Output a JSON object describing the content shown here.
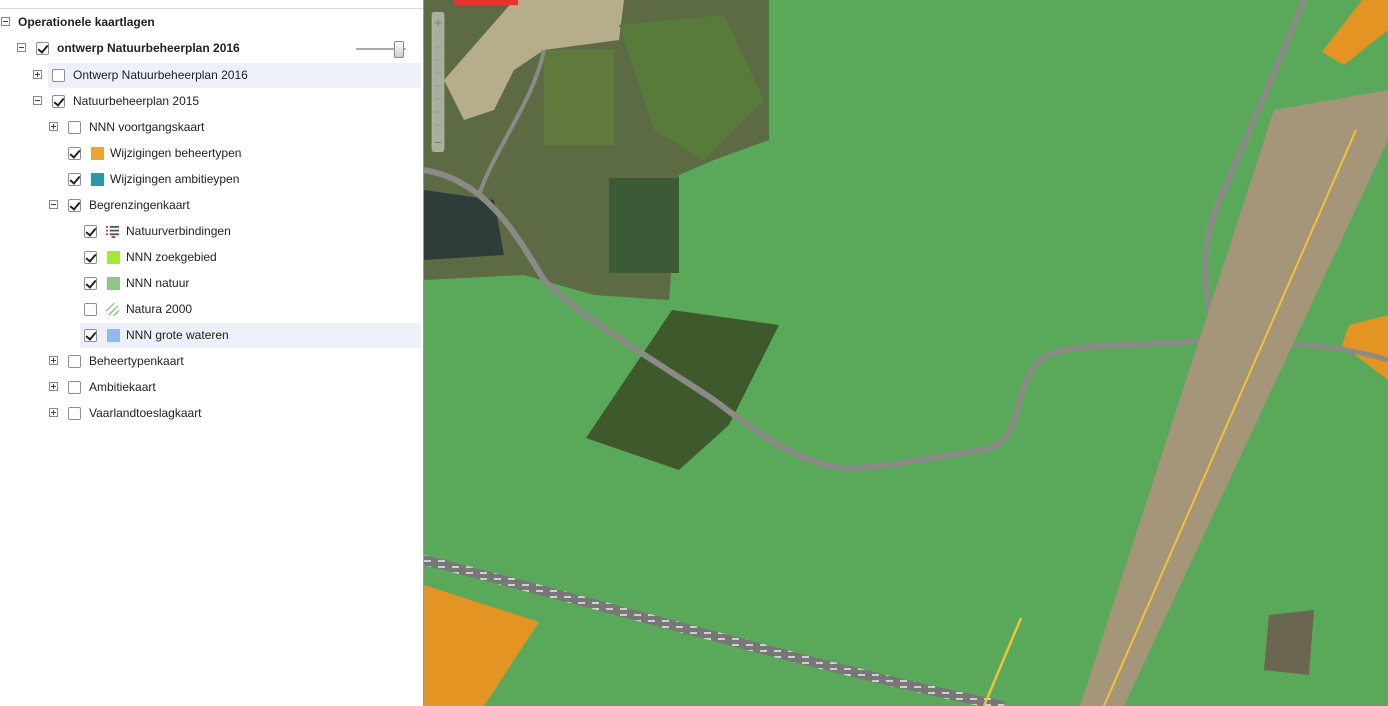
{
  "toc": {
    "root_label": "Operationele kaartlagen",
    "items": [
      {
        "label": "ontwerp Natuurbeheerplan 2016",
        "checked": true,
        "expander": "minus"
      },
      {
        "label": "Ontwerp Natuurbeheerplan 2016",
        "checked": false,
        "expander": "plus"
      },
      {
        "label": "Natuurbeheerplan 2015",
        "checked": true,
        "expander": "minus"
      },
      {
        "label": "NNN voortgangskaart",
        "checked": false,
        "expander": "plus"
      },
      {
        "label": "Wijzigingen beheertypen",
        "checked": true,
        "swatch": "#e8a532"
      },
      {
        "label": "Wijzigingen ambitieypen",
        "checked": true,
        "swatch": "#2b97a9"
      },
      {
        "label": "Begrenzingenkaart",
        "checked": true,
        "expander": "minus"
      },
      {
        "label": "Natuurverbindingen",
        "checked": true,
        "icon": "lines-legend-icon"
      },
      {
        "label": "NNN zoekgebied",
        "checked": true,
        "swatch": "#a6e83a"
      },
      {
        "label": "NNN natuur",
        "checked": true,
        "swatch": "#93c48c"
      },
      {
        "label": "Natura 2000",
        "checked": false,
        "icon": "hatch-legend-icon"
      },
      {
        "label": "NNN grote wateren",
        "checked": true,
        "swatch": "#8fb9f0"
      },
      {
        "label": "Beheertypenkaart",
        "checked": false,
        "expander": "plus"
      },
      {
        "label": "Ambitiekaart",
        "checked": false,
        "expander": "plus"
      },
      {
        "label": "Vaarlandtoeslagkaart",
        "checked": false,
        "expander": "plus"
      }
    ],
    "opacity": 0.8
  },
  "colors": {
    "nature_green": "#5fb05f",
    "change_orange": "#e39422",
    "road": "#8a8a86",
    "rail_accent": "#f0c23a",
    "red_tab": "#e8332b"
  }
}
